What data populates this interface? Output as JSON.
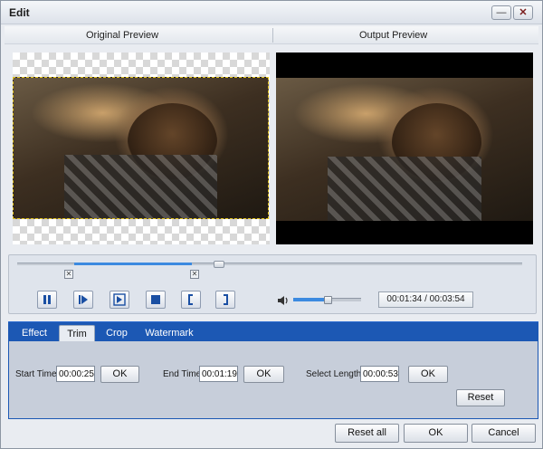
{
  "window": {
    "title": "Edit",
    "min_symbol": "—",
    "close_symbol": "✕"
  },
  "preview_header": {
    "original": "Original Preview",
    "output": "Output Preview"
  },
  "playback": {
    "time_display": "00:01:34 / 00:03:54",
    "volume_level": 0.5,
    "position_fraction": 0.4
  },
  "tabs": [
    {
      "label": "Effect"
    },
    {
      "label": "Trim"
    },
    {
      "label": "Crop"
    },
    {
      "label": "Watermark"
    }
  ],
  "trim": {
    "start_label": "Start Time",
    "start_value": "00:00:25",
    "start_ok": "OK",
    "end_label": "End Time",
    "end_value": "00:01:19",
    "end_ok": "OK",
    "length_label": "Select Length",
    "length_value": "00:00:53",
    "length_ok": "OK",
    "reset_label": "Reset"
  },
  "footer": {
    "reset_all": "Reset all",
    "ok": "OK",
    "cancel": "Cancel"
  },
  "colors": {
    "accent": "#1c58b4",
    "slider_fill": "#3c8ae0",
    "crop_border": "#e3c51d"
  }
}
